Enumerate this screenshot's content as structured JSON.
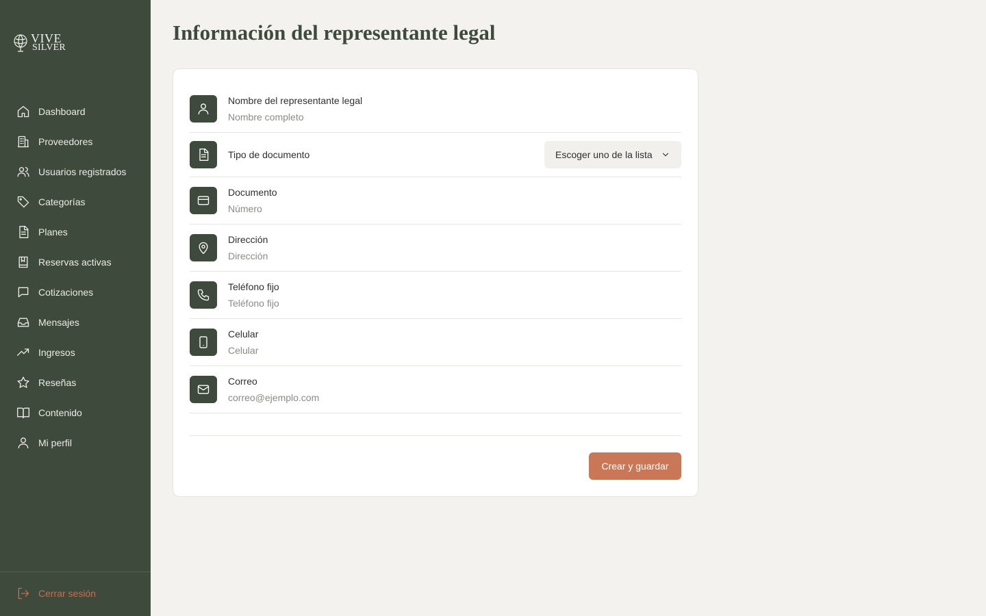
{
  "brand": {
    "line1": "VIVE",
    "line2": "SILVER",
    "sidebar_color": "#3e4a3b",
    "accent_color": "#c97756",
    "logout_color": "#cf6a4c"
  },
  "sidebar": {
    "items": [
      {
        "label": "Dashboard",
        "icon": "home-icon"
      },
      {
        "label": "Proveedores",
        "icon": "building-icon"
      },
      {
        "label": "Usuarios registrados",
        "icon": "users-icon"
      },
      {
        "label": "Categorías",
        "icon": "tag-icon"
      },
      {
        "label": "Planes",
        "icon": "document-icon"
      },
      {
        "label": "Reservas activas",
        "icon": "bookmark-book-icon"
      },
      {
        "label": "Cotizaciones",
        "icon": "chat-icon"
      },
      {
        "label": "Mensajes",
        "icon": "inbox-icon"
      },
      {
        "label": "Ingresos",
        "icon": "trending-up-icon"
      },
      {
        "label": "Reseñas",
        "icon": "star-icon"
      },
      {
        "label": "Contenido",
        "icon": "book-open-icon"
      },
      {
        "label": "Mi perfil",
        "icon": "user-icon"
      }
    ],
    "logout": {
      "label": "Cerrar sesión",
      "icon": "logout-icon"
    }
  },
  "page": {
    "title": "Información del representante legal"
  },
  "form": {
    "rows": [
      {
        "label": "Nombre del representante legal",
        "placeholder": "Nombre completo",
        "value": "",
        "icon": "user-icon"
      },
      {
        "label": "Tipo de documento",
        "select_value": "Escoger uno de la lista",
        "icon": "document-icon"
      },
      {
        "label": "Documento",
        "placeholder": "Número",
        "value": "",
        "icon": "credit-card-icon"
      },
      {
        "label": "Dirección",
        "placeholder": "Dirección",
        "value": "",
        "icon": "map-pin-icon"
      },
      {
        "label": "Teléfono fijo",
        "placeholder": "Teléfono fijo",
        "value": "",
        "icon": "phone-icon"
      },
      {
        "label": "Celular",
        "placeholder": "Celular",
        "value": "",
        "icon": "smartphone-icon"
      },
      {
        "label": "Correo",
        "placeholder": "correo@ejemplo.com",
        "value": "",
        "icon": "mail-icon"
      }
    ],
    "submit_label": "Crear y guardar"
  }
}
